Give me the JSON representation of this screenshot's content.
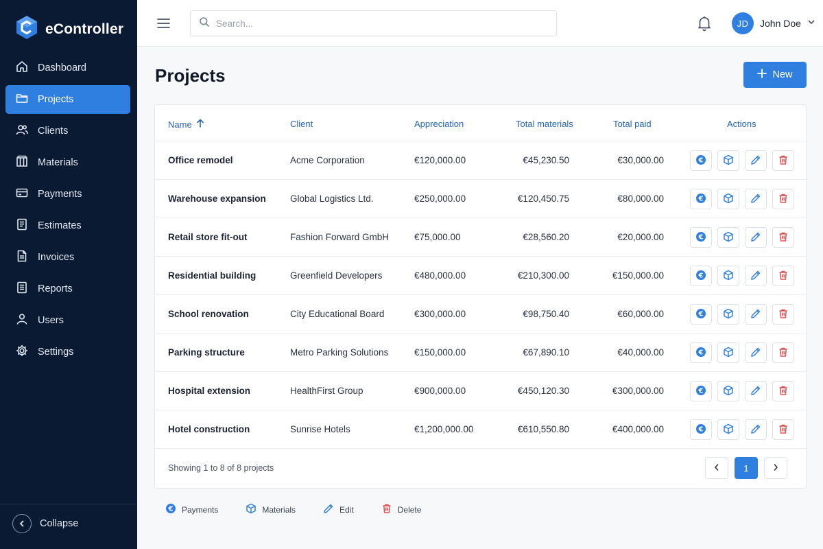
{
  "app": {
    "name": "eController"
  },
  "colors": {
    "sidebar": "#0b1a33",
    "accent": "#2f7fe0",
    "delete": "#e05151",
    "header_text": "#2464b8"
  },
  "sidebar": {
    "items": [
      {
        "label": "Dashboard",
        "icon": "home-icon"
      },
      {
        "label": "Projects",
        "icon": "folder-icon",
        "active": true
      },
      {
        "label": "Clients",
        "icon": "clients-icon"
      },
      {
        "label": "Materials",
        "icon": "materials-icon"
      },
      {
        "label": "Payments",
        "icon": "card-icon"
      },
      {
        "label": "Estimates",
        "icon": "estimate-icon"
      },
      {
        "label": "Invoices",
        "icon": "invoice-icon"
      },
      {
        "label": "Reports",
        "icon": "report-icon"
      },
      {
        "label": "Users",
        "icon": "user-icon"
      },
      {
        "label": "Settings",
        "icon": "gear-icon"
      }
    ],
    "collapse_label": "Collapse"
  },
  "topbar": {
    "search_placeholder": "Search...",
    "user": {
      "initials": "JD",
      "name": "John Doe"
    }
  },
  "page": {
    "title": "Projects",
    "new_label": "New"
  },
  "table": {
    "columns": {
      "name": "Name",
      "client": "Client",
      "appreciation": "Appreciation",
      "total_materials": "Total materials",
      "total_paid": "Total paid",
      "actions": "Actions"
    },
    "rows": [
      {
        "name": "Office remodel",
        "client": "Acme Corporation",
        "appreciation": "€120,000.00",
        "materials": "€45,230.50",
        "paid": "€30,000.00"
      },
      {
        "name": "Warehouse expansion",
        "client": "Global Logistics Ltd.",
        "appreciation": "€250,000.00",
        "materials": "€120,450.75",
        "paid": "€80,000.00"
      },
      {
        "name": "Retail store fit-out",
        "client": "Fashion Forward GmbH",
        "appreciation": "€75,000.00",
        "materials": "€28,560.20",
        "paid": "€20,000.00"
      },
      {
        "name": "Residential building",
        "client": "Greenfield Developers",
        "appreciation": "€480,000.00",
        "materials": "€210,300.00",
        "paid": "€150,000.00"
      },
      {
        "name": "School renovation",
        "client": "City Educational Board",
        "appreciation": "€300,000.00",
        "materials": "€98,750.40",
        "paid": "€60,000.00"
      },
      {
        "name": "Parking structure",
        "client": "Metro Parking Solutions",
        "appreciation": "€150,000.00",
        "materials": "€67,890.10",
        "paid": "€40,000.00"
      },
      {
        "name": "Hospital extension",
        "client": "HealthFirst Group",
        "appreciation": "€900,000.00",
        "materials": "€450,120.30",
        "paid": "€300,000.00"
      },
      {
        "name": "Hotel construction",
        "client": "Sunrise Hotels",
        "appreciation": "€1,200,000.00",
        "materials": "€610,550.80",
        "paid": "€400,000.00"
      }
    ],
    "footer_text": "Showing 1 to 8 of 8 projects",
    "current_page": "1"
  },
  "legend": {
    "payments": "Payments",
    "materials": "Materials",
    "edit": "Edit",
    "delete": "Delete"
  }
}
